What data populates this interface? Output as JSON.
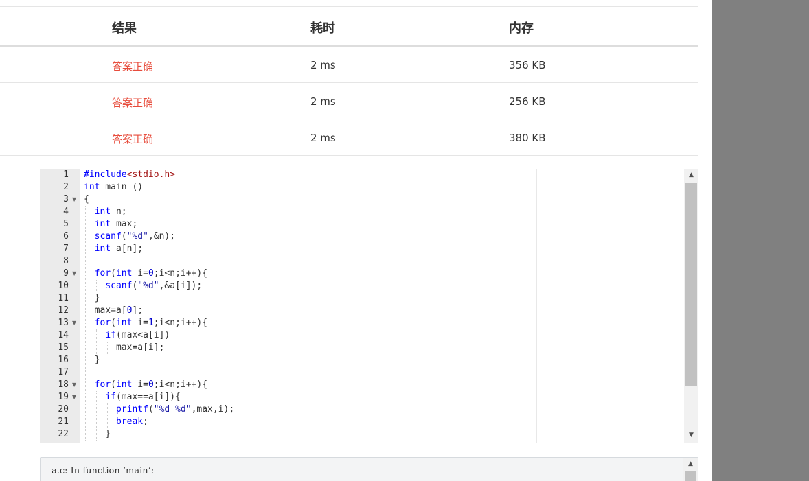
{
  "results_table": {
    "headers": [
      "结果",
      "耗时",
      "内存"
    ],
    "rows": [
      {
        "result": "答案正确",
        "time": "2 ms",
        "memory": "356 KB"
      },
      {
        "result": "答案正确",
        "time": "2 ms",
        "memory": "256 KB"
      },
      {
        "result": "答案正确",
        "time": "2 ms",
        "memory": "380 KB"
      }
    ]
  },
  "editor": {
    "line_numbers": [
      "1",
      "2",
      "3",
      "4",
      "5",
      "6",
      "7",
      "8",
      "9",
      "10",
      "11",
      "12",
      "13",
      "14",
      "15",
      "16",
      "17",
      "18",
      "19",
      "20",
      "21",
      "22"
    ],
    "folded_lines": [
      3,
      9,
      13,
      18,
      19
    ],
    "lines": [
      [
        {
          "t": "#include",
          "c": "pre"
        },
        {
          "t": "<stdio.h>",
          "c": "inc"
        }
      ],
      [
        {
          "t": "int",
          "c": "kw"
        },
        {
          "t": " main ()",
          "c": ""
        }
      ],
      [
        {
          "t": "{",
          "c": ""
        }
      ],
      [
        {
          "t": "  ",
          "c": ""
        },
        {
          "t": "int",
          "c": "kw"
        },
        {
          "t": " n;",
          "c": ""
        }
      ],
      [
        {
          "t": "  ",
          "c": ""
        },
        {
          "t": "int",
          "c": "kw"
        },
        {
          "t": " max;",
          "c": ""
        }
      ],
      [
        {
          "t": "  ",
          "c": ""
        },
        {
          "t": "scanf",
          "c": "kw"
        },
        {
          "t": "(",
          "c": ""
        },
        {
          "t": "\"%d\"",
          "c": "str"
        },
        {
          "t": ",&n);",
          "c": ""
        }
      ],
      [
        {
          "t": "  ",
          "c": ""
        },
        {
          "t": "int",
          "c": "kw"
        },
        {
          "t": " a[n];",
          "c": ""
        }
      ],
      [
        {
          "t": "",
          "c": ""
        }
      ],
      [
        {
          "t": "  ",
          "c": ""
        },
        {
          "t": "for",
          "c": "kw"
        },
        {
          "t": "(",
          "c": ""
        },
        {
          "t": "int",
          "c": "kw"
        },
        {
          "t": " i=",
          "c": ""
        },
        {
          "t": "0",
          "c": "num"
        },
        {
          "t": ";i<n;i++){",
          "c": ""
        }
      ],
      [
        {
          "t": "    ",
          "c": ""
        },
        {
          "t": "scanf",
          "c": "kw"
        },
        {
          "t": "(",
          "c": ""
        },
        {
          "t": "\"%d\"",
          "c": "str"
        },
        {
          "t": ",&a[i]);",
          "c": ""
        }
      ],
      [
        {
          "t": "  }",
          "c": ""
        }
      ],
      [
        {
          "t": "  max=a[",
          "c": ""
        },
        {
          "t": "0",
          "c": "num"
        },
        {
          "t": "];",
          "c": ""
        }
      ],
      [
        {
          "t": "  ",
          "c": ""
        },
        {
          "t": "for",
          "c": "kw"
        },
        {
          "t": "(",
          "c": ""
        },
        {
          "t": "int",
          "c": "kw"
        },
        {
          "t": " i=",
          "c": ""
        },
        {
          "t": "1",
          "c": "num"
        },
        {
          "t": ";i<n;i++){",
          "c": ""
        }
      ],
      [
        {
          "t": "    ",
          "c": ""
        },
        {
          "t": "if",
          "c": "kw"
        },
        {
          "t": "(max<a[i])",
          "c": ""
        }
      ],
      [
        {
          "t": "      max=a[i];",
          "c": ""
        }
      ],
      [
        {
          "t": "  }",
          "c": ""
        }
      ],
      [
        {
          "t": "",
          "c": ""
        }
      ],
      [
        {
          "t": "  ",
          "c": ""
        },
        {
          "t": "for",
          "c": "kw"
        },
        {
          "t": "(",
          "c": ""
        },
        {
          "t": "int",
          "c": "kw"
        },
        {
          "t": " i=",
          "c": ""
        },
        {
          "t": "0",
          "c": "num"
        },
        {
          "t": ";i<n;i++){",
          "c": ""
        }
      ],
      [
        {
          "t": "    ",
          "c": ""
        },
        {
          "t": "if",
          "c": "kw"
        },
        {
          "t": "(max==a[i]){",
          "c": ""
        }
      ],
      [
        {
          "t": "      ",
          "c": ""
        },
        {
          "t": "printf",
          "c": "kw"
        },
        {
          "t": "(",
          "c": ""
        },
        {
          "t": "\"%d %d\"",
          "c": "str"
        },
        {
          "t": ",max,i);",
          "c": ""
        }
      ],
      [
        {
          "t": "      ",
          "c": ""
        },
        {
          "t": "break",
          "c": "kw"
        },
        {
          "t": ";",
          "c": ""
        }
      ],
      [
        {
          "t": "    }",
          "c": ""
        }
      ]
    ],
    "scroll_position": 0.0
  },
  "compile_output": {
    "message": "a.c: In function ‘main’:"
  },
  "colors": {
    "accepted": "#e74c3c",
    "side_panel": "#808080",
    "gutter": "#ebebeb"
  }
}
